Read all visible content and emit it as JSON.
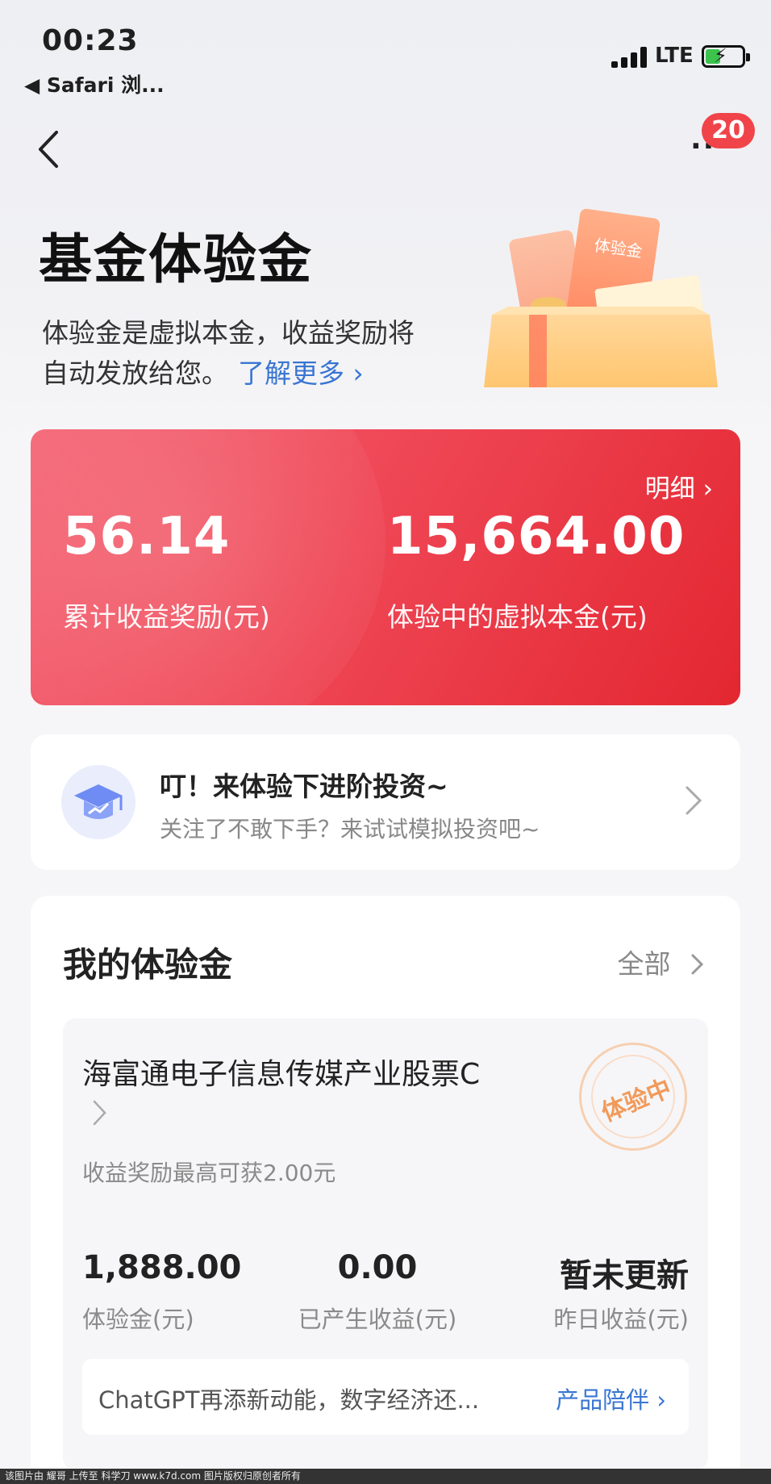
{
  "status_bar": {
    "time": "00:23",
    "back_app": "◀ Safari 浏...",
    "network": "LTE",
    "battery_icon": "battery-charging-icon"
  },
  "nav": {
    "more_icon": "more-icon",
    "badge_count": "20"
  },
  "header": {
    "title": "基金体验金",
    "desc_line1": "体验金是虚拟本金，收益奖励将",
    "desc_line2": "自动发放给您。",
    "learn_more": "了解更多 ›",
    "illustration_label": "体验金"
  },
  "summary": {
    "detail_link": "明细 ›",
    "total_reward_value": "56.14",
    "total_reward_label": "累计收益奖励(元)",
    "virtual_principal_value": "15,664.00",
    "virtual_principal_label": "体验中的虚拟本金(元)",
    "accent": "#ef4655"
  },
  "promo": {
    "title": "叮！来体验下进阶投资~",
    "subtitle": "关注了不敢下手？来试试模拟投资吧~",
    "icon": "graduation-cap-icon"
  },
  "my_funds": {
    "title": "我的体验金",
    "all_link": "全部",
    "fund": {
      "name": "海富通电子信息传媒产业股票C",
      "subtitle": "收益奖励最高可获2.00元",
      "stamp": "体验中",
      "stats": [
        {
          "value": "1,888.00",
          "label": "体验金(元)"
        },
        {
          "value": "0.00",
          "label": "已产生收益(元)"
        },
        {
          "value": "暂未更新",
          "label": "昨日收益(元)"
        }
      ],
      "news_text": "ChatGPT再添新动能，数字经济还...",
      "news_link": "产品陪伴 ›"
    }
  },
  "footer": "该图片由 耀哥 上传至 科学刀 www.k7d.com 图片版权归原创者所有",
  "colors": {
    "link_blue": "#3a76d3",
    "badge_red": "#f0444a",
    "stamp_orange": "#f19a5a"
  }
}
